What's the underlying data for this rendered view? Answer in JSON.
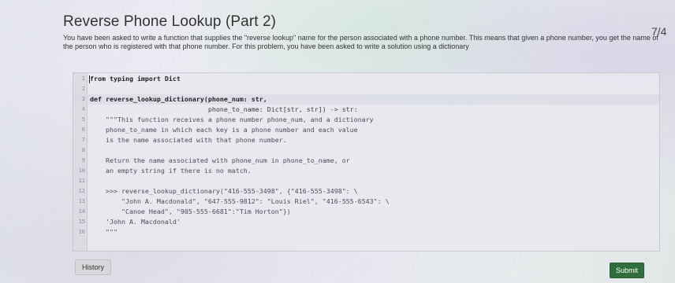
{
  "header": {
    "title": "Reverse Phone Lookup (Part 2)",
    "counter": "7/4",
    "description": "You have been asked to write a function that supplies the \"reverse lookup\" name for the person associated with a phone number. This means that given a phone number, you get the name of the person who is registered with that phone number. For this problem, you have been asked to write a solution using a dictionary"
  },
  "editor": {
    "lines": [
      {
        "num": "1",
        "code": "from typing import Dict"
      },
      {
        "num": "2",
        "code": ""
      },
      {
        "num": "3",
        "code": "def reverse_lookup_dictionary(phone_num: str,"
      },
      {
        "num": "4",
        "code": "                              phone_to_name: Dict[str, str]) -> str:"
      },
      {
        "num": "5",
        "code": "    \"\"\"This function receives a phone number phone_num, and a dictionary"
      },
      {
        "num": "6",
        "code": "    phone_to_name in which each key is a phone number and each value"
      },
      {
        "num": "7",
        "code": "    is the name associated with that phone number."
      },
      {
        "num": "8",
        "code": ""
      },
      {
        "num": "9",
        "code": "    Return the name associated with phone_num in phone_to_name, or"
      },
      {
        "num": "10",
        "code": "    an empty string if there is no match."
      },
      {
        "num": "11",
        "code": ""
      },
      {
        "num": "12",
        "code": "    >>> reverse_lookup_dictionary(\"416-555-3498\", {\"416-555-3498\": \\"
      },
      {
        "num": "13",
        "code": "        \"John A. Macdonald\", \"647-555-9812\": \"Louis Riel\", \"416-555-6543\": \\"
      },
      {
        "num": "14",
        "code": "        \"Canoe Head\", \"905-555-6681\":\"Tim Horton\"})"
      },
      {
        "num": "15",
        "code": "    'John A. Macdonald'"
      },
      {
        "num": "16",
        "code": "    \"\"\""
      }
    ]
  },
  "footer": {
    "history_label": "History",
    "submit_label": "Submit"
  },
  "colors": {
    "submit_bg": "#2f6e3c",
    "history_bg": "#d6d8da"
  }
}
